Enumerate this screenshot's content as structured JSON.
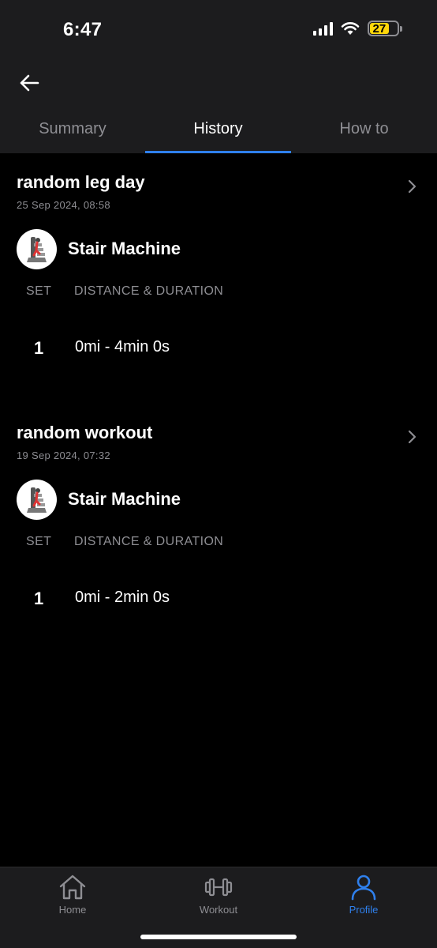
{
  "status_bar": {
    "time": "6:47",
    "battery": "27",
    "battery_color": "#ffd60a"
  },
  "nav": {
    "back_icon": "arrow-left-icon"
  },
  "tabs": [
    {
      "label": "Summary",
      "active": false
    },
    {
      "label": "History",
      "active": true
    },
    {
      "label": "How to",
      "active": false
    }
  ],
  "accent_color": "#2f80ed",
  "history": [
    {
      "title": "random leg day",
      "date": "25 Sep 2024, 08:58",
      "exercise": "Stair Machine",
      "columns": {
        "set": "SET",
        "metric": "DISTANCE & DURATION"
      },
      "sets": [
        {
          "number": "1",
          "value": "0mi - 4min 0s"
        }
      ]
    },
    {
      "title": "random workout",
      "date": "19 Sep 2024, 07:32",
      "exercise": "Stair Machine",
      "columns": {
        "set": "SET",
        "metric": "DISTANCE & DURATION"
      },
      "sets": [
        {
          "number": "1",
          "value": "0mi - 2min 0s"
        }
      ]
    }
  ],
  "bottom_nav": [
    {
      "label": "Home",
      "icon": "home-icon",
      "active": false
    },
    {
      "label": "Workout",
      "icon": "dumbbell-icon",
      "active": false
    },
    {
      "label": "Profile",
      "icon": "person-icon",
      "active": true
    }
  ]
}
